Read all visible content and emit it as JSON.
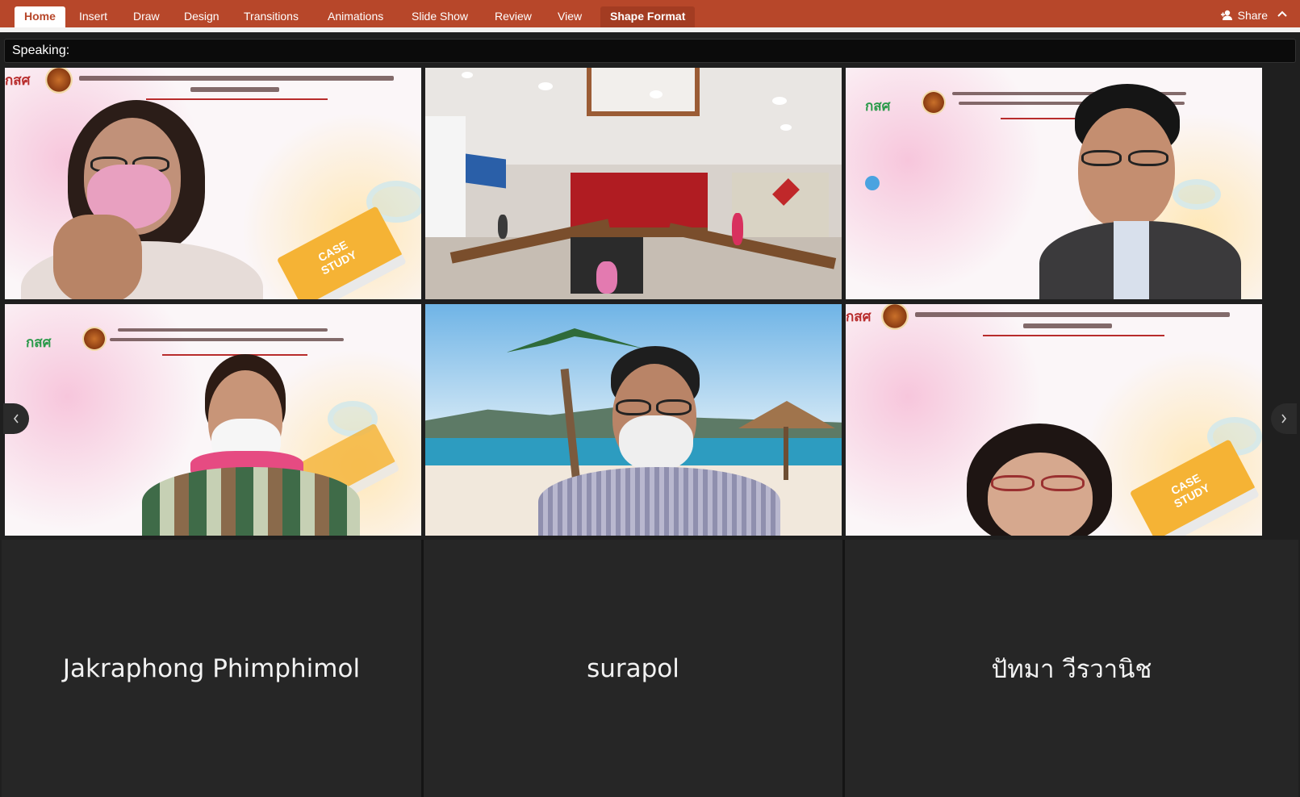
{
  "ribbon": {
    "tabs": [
      {
        "label": "Home",
        "active": true
      },
      {
        "label": "Insert"
      },
      {
        "label": "Draw"
      },
      {
        "label": "Design"
      },
      {
        "label": "Transitions"
      },
      {
        "label": "Animations"
      },
      {
        "label": "Slide Show"
      },
      {
        "label": "Review"
      },
      {
        "label": "View"
      },
      {
        "label": "Shape Format",
        "contextual": true
      }
    ],
    "share_label": "Share",
    "accent_color": "#b7472a"
  },
  "meeting": {
    "speaking_label": "Speaking:",
    "participants": [
      {
        "name": "Jakraphong Phimphimol",
        "video": "slide-woman-pink-mask"
      },
      {
        "name": "surapol",
        "video": "beach-man-mask"
      },
      {
        "name": "ปัทมา วีรวานิช",
        "video": "slide-woman-glasses"
      }
    ],
    "video_tiles": [
      {
        "id": "woman-pink-mask",
        "slide_logo": "กสศ"
      },
      {
        "id": "conference-room"
      },
      {
        "id": "man-glasses",
        "slide_logo": "กสศ"
      },
      {
        "id": "woman-white-mask",
        "slide_logo": "กสศ"
      },
      {
        "id": "beach-man"
      },
      {
        "id": "woman-red-glasses",
        "slide_logo": "กสศ"
      }
    ],
    "case_study_label": "CASE STUDY",
    "nav_prev_icon": "chevron-left-icon",
    "nav_next_icon": "chevron-right-icon"
  }
}
